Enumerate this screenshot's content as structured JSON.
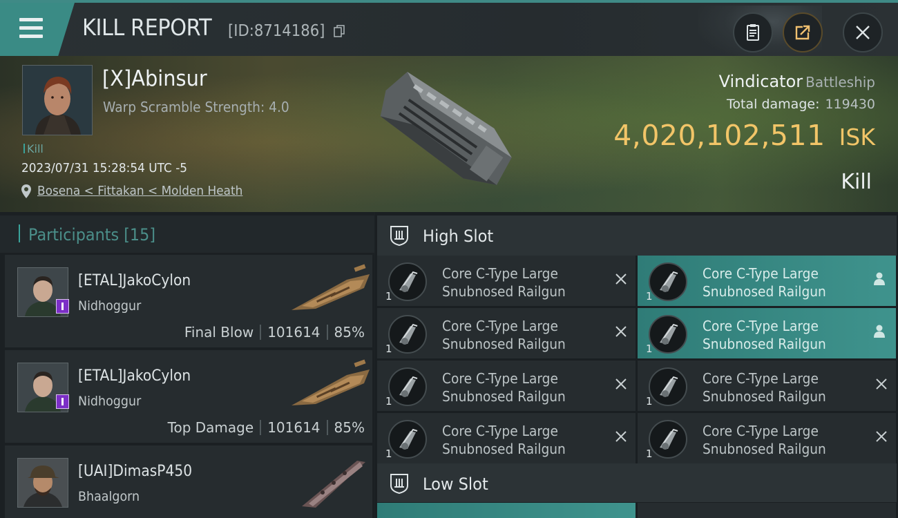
{
  "header": {
    "title": "KILL REPORT",
    "report_id": "[ID:8714186]"
  },
  "victim": {
    "name": "[X]Abinsur",
    "warp_scramble": "Warp Scramble Strength: 4.0",
    "kill_tag": "Kill",
    "datetime": "2023/07/31 15:28:54 UTC -5",
    "location": "Bosena < Fittakan < Molden Heath",
    "ship_name": "Vindicator",
    "ship_class": "Battleship",
    "total_damage_label": "Total damage:",
    "total_damage_value": "119430",
    "isk_value": "4,020,102,511",
    "isk_unit": "ISK",
    "result": "Kill"
  },
  "participants": {
    "title": "Participants",
    "count": "[15]",
    "rows": [
      {
        "name": "[ETAL]JakoCylon",
        "ship": "Nidhoggur",
        "role": "Final Blow",
        "damage": "101614",
        "percent": "85%"
      },
      {
        "name": "[ETAL]JakoCylon",
        "ship": "Nidhoggur",
        "role": "Top Damage",
        "damage": "101614",
        "percent": "85%"
      },
      {
        "name": "[UAI]DimasP450",
        "ship": "Bhaalgorn",
        "role": "",
        "damage": "",
        "percent": ""
      }
    ]
  },
  "slots": {
    "high_title": "High Slot",
    "low_title": "Low Slot",
    "high_modules": [
      {
        "line1": "Core C-Type Large",
        "line2": "Snubnosed Railgun",
        "qty": "1",
        "state": "destroyed"
      },
      {
        "line1": "Core C-Type Large",
        "line2": "Snubnosed Railgun",
        "qty": "1",
        "state": "dropped"
      },
      {
        "line1": "Core C-Type Large",
        "line2": "Snubnosed Railgun",
        "qty": "1",
        "state": "destroyed"
      },
      {
        "line1": "Core C-Type Large",
        "line2": "Snubnosed Railgun",
        "qty": "1",
        "state": "dropped"
      },
      {
        "line1": "Core C-Type Large",
        "line2": "Snubnosed Railgun",
        "qty": "1",
        "state": "destroyed"
      },
      {
        "line1": "Core C-Type Large",
        "line2": "Snubnosed Railgun",
        "qty": "1",
        "state": "destroyed"
      },
      {
        "line1": "Core C-Type Large",
        "line2": "Snubnosed Railgun",
        "qty": "1",
        "state": "destroyed"
      },
      {
        "line1": "Core C-Type Large",
        "line2": "Snubnosed Railgun",
        "qty": "1",
        "state": "destroyed"
      }
    ]
  },
  "icons": [
    "menu-icon",
    "copy-icon",
    "clipboard-icon",
    "share-icon",
    "close-icon",
    "location-pin-icon",
    "slot-icon",
    "x-icon",
    "person-icon"
  ],
  "colors": {
    "accent": "#3a8b85",
    "isk": "#f2c568",
    "badge": "#7c2fc7"
  }
}
